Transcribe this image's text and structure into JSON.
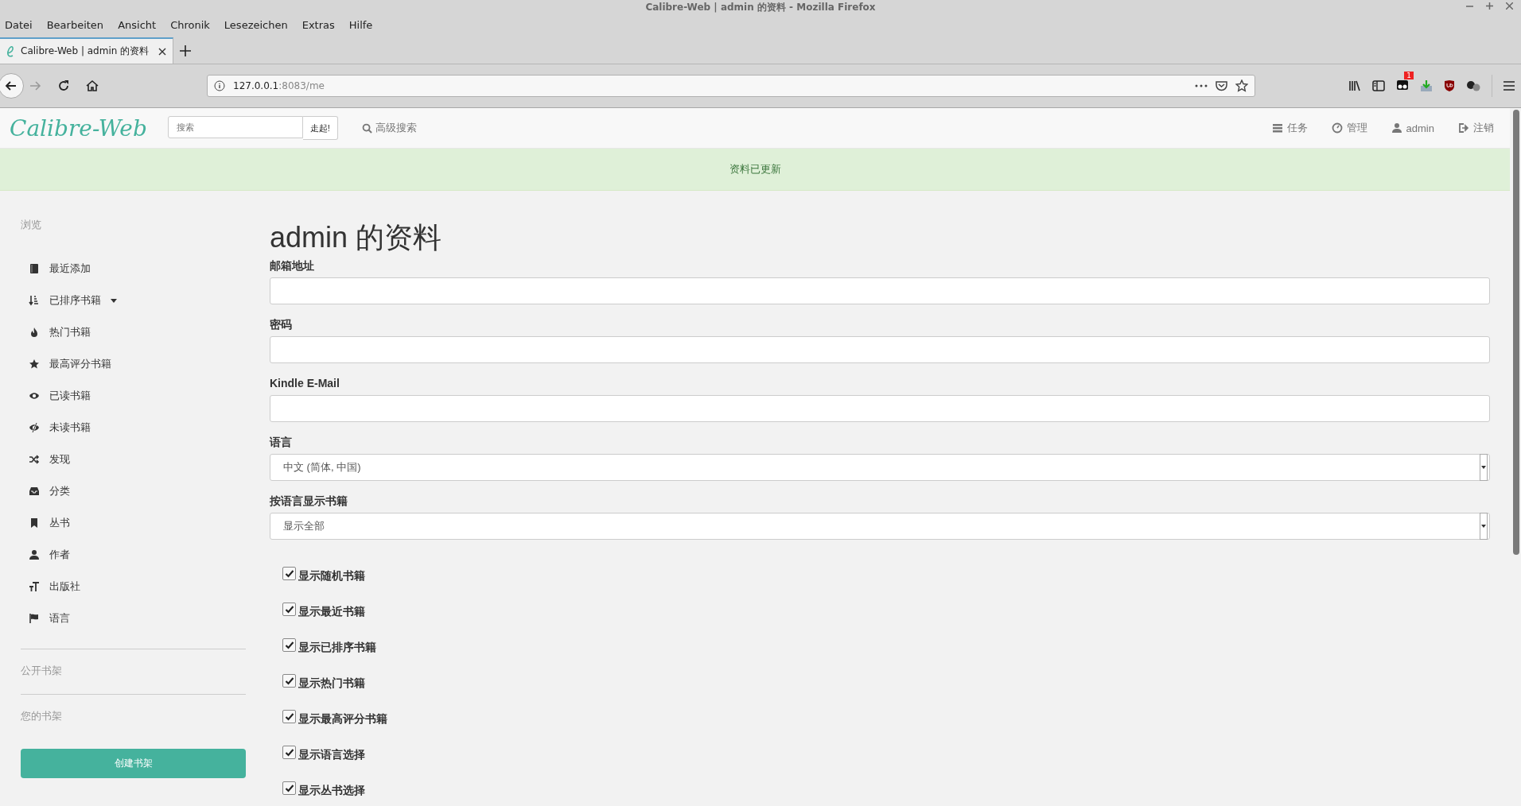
{
  "window": {
    "title": "Calibre-Web | admin 的资料 - Mozilla Firefox"
  },
  "menu": [
    "Datei",
    "Bearbeiten",
    "Ansicht",
    "Chronik",
    "Lesezeichen",
    "Extras",
    "Hilfe"
  ],
  "tab": {
    "title": "Calibre-Web | admin 的资料",
    "selected": true
  },
  "address": {
    "host": "127.0.0.1",
    "path": ":8083/me"
  },
  "toolbar_badge": "1",
  "navbar": {
    "brand": "Calibre-Web",
    "search_placeholder": "搜索",
    "search_button": "走起!",
    "advanced_search": "高级搜索",
    "links": [
      {
        "kind": "tasks",
        "label": "任务"
      },
      {
        "kind": "dashboard",
        "label": "管理"
      },
      {
        "kind": "user",
        "label": "admin"
      },
      {
        "kind": "logout",
        "label": "注销"
      }
    ]
  },
  "alert": "资料已更新",
  "sidebar": {
    "heading": "浏览",
    "items": [
      {
        "kind": "book",
        "label": "最近添加",
        "caret": false
      },
      {
        "kind": "sort",
        "label": "已排序书籍",
        "caret": true
      },
      {
        "kind": "fire",
        "label": "热门书籍",
        "caret": false
      },
      {
        "kind": "star",
        "label": "最高评分书籍",
        "caret": false
      },
      {
        "kind": "eye",
        "label": "已读书籍",
        "caret": false
      },
      {
        "kind": "eye-off",
        "label": "未读书籍",
        "caret": false
      },
      {
        "kind": "shuffle",
        "label": "发现",
        "caret": false
      },
      {
        "kind": "inbox",
        "label": "分类",
        "caret": false
      },
      {
        "kind": "bookmark",
        "label": "丛书",
        "caret": false
      },
      {
        "kind": "user",
        "label": "作者",
        "caret": false
      },
      {
        "kind": "text",
        "label": "出版社",
        "caret": false
      },
      {
        "kind": "flag",
        "label": "语言",
        "caret": false
      }
    ],
    "public_shelves": "公开书架",
    "your_shelves": "您的书架",
    "create_shelf": "创建书架"
  },
  "form": {
    "title": "admin 的资料",
    "fields": [
      {
        "kind": "text",
        "label": "邮箱地址"
      },
      {
        "kind": "password",
        "label": "密码"
      },
      {
        "kind": "text",
        "label": "Kindle E-Mail"
      },
      {
        "kind": "select",
        "label": "语言",
        "value": "中文 (简体, 中国)"
      },
      {
        "kind": "select",
        "label": "按语言显示书籍",
        "value": "显示全部"
      }
    ],
    "checkboxes": [
      {
        "label": "显示随机书籍",
        "checked": true
      },
      {
        "label": "显示最近书籍",
        "checked": true
      },
      {
        "label": "显示已排序书籍",
        "checked": true
      },
      {
        "label": "显示热门书籍",
        "checked": true
      },
      {
        "label": "显示最高评分书籍",
        "checked": true
      },
      {
        "label": "显示语言选择",
        "checked": true
      },
      {
        "label": "显示丛书选择",
        "checked": true
      }
    ]
  }
}
